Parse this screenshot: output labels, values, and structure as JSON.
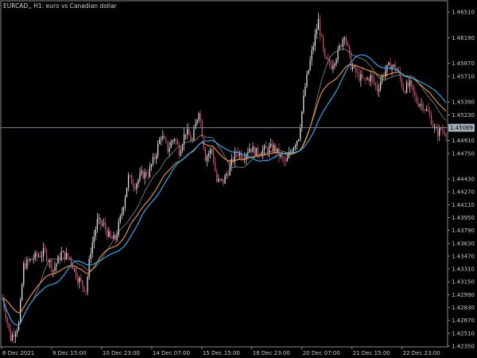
{
  "header": {
    "title": "EURCAD,, H1:  euro vs Canadian dollar"
  },
  "colors": {
    "background": "#000000",
    "axis": "#8a8a8a",
    "text": "#c8c8c8",
    "bull_candle": "#e8e8e8",
    "bear_candle": "#d0506e",
    "ma_fast": "#8a8a8a",
    "ma_orange": "#f59a3c",
    "ma_blue": "#29a8f0",
    "current_price_line": "#7a8f9a",
    "current_price_box": "#9fb1ba"
  },
  "chart_data": {
    "type": "candlestick",
    "ylim": [
      1.4234,
      1.4665
    ],
    "yticks": [
      "1.46510",
      "1.46190",
      "1.45870",
      "1.45710",
      "1.45390",
      "1.45230",
      "1.44910",
      "1.44750",
      "1.44430",
      "1.44270",
      "1.44110",
      "1.43950",
      "1.43790",
      "1.43630",
      "1.43470",
      "1.43310",
      "1.43150",
      "1.42990",
      "1.42830",
      "1.42670",
      "1.42510",
      "1.42350"
    ],
    "xticks": [
      "8 Dec 2021",
      "9 Dec 15:00",
      "10 Dec 23:00",
      "14 Dec 07:00",
      "15 Dec 15:00",
      "16 Dec 23:00",
      "20 Dec 07:00",
      "21 Dec 15:00",
      "22 Dec 23:00"
    ],
    "current_price": "1.45069",
    "anchors": [
      [
        0,
        1.4295
      ],
      [
        5,
        1.4245
      ],
      [
        10,
        1.4262
      ],
      [
        13,
        1.4335
      ],
      [
        19,
        1.4345
      ],
      [
        26,
        1.4352
      ],
      [
        31,
        1.433
      ],
      [
        36,
        1.435
      ],
      [
        41,
        1.4345
      ],
      [
        46,
        1.432
      ],
      [
        51,
        1.4305
      ],
      [
        54,
        1.4355
      ],
      [
        58,
        1.439
      ],
      [
        62,
        1.4385
      ],
      [
        66,
        1.4368
      ],
      [
        69,
        1.4368
      ],
      [
        73,
        1.4402
      ],
      [
        77,
        1.4445
      ],
      [
        81,
        1.4436
      ],
      [
        85,
        1.4448
      ],
      [
        89,
        1.445
      ],
      [
        93,
        1.447
      ],
      [
        97,
        1.4498
      ],
      [
        101,
        1.448
      ],
      [
        105,
        1.4495
      ],
      [
        108,
        1.4478
      ],
      [
        112,
        1.4503
      ],
      [
        116,
        1.449
      ],
      [
        120,
        1.453
      ],
      [
        124,
        1.447
      ],
      [
        128,
        1.448
      ],
      [
        131,
        1.444
      ],
      [
        135,
        1.444
      ],
      [
        139,
        1.4458
      ],
      [
        143,
        1.4477
      ],
      [
        147,
        1.4472
      ],
      [
        151,
        1.4482
      ],
      [
        155,
        1.4476
      ],
      [
        158,
        1.4478
      ],
      [
        162,
        1.448
      ],
      [
        166,
        1.4482
      ],
      [
        170,
        1.447
      ],
      [
        173,
        1.4462
      ],
      [
        177,
        1.4482
      ],
      [
        181,
        1.4496
      ],
      [
        185,
        1.4558
      ],
      [
        189,
        1.46
      ],
      [
        193,
        1.464
      ],
      [
        197,
        1.459
      ],
      [
        201,
        1.4585
      ],
      [
        205,
        1.46
      ],
      [
        209,
        1.4625
      ],
      [
        213,
        1.4585
      ],
      [
        217,
        1.4572
      ],
      [
        221,
        1.4565
      ],
      [
        225,
        1.457
      ],
      [
        229,
        1.4555
      ],
      [
        233,
        1.4575
      ],
      [
        237,
        1.4585
      ],
      [
        241,
        1.458
      ],
      [
        245,
        1.4555
      ],
      [
        249,
        1.456
      ],
      [
        253,
        1.454
      ],
      [
        257,
        1.4535
      ],
      [
        261,
        1.4522
      ],
      [
        265,
        1.45
      ],
      [
        268,
        1.4505
      ],
      [
        271,
        1.4502
      ]
    ],
    "candle_count": 272,
    "moving_averages": [
      {
        "color_key": "ma_fast",
        "period": 12
      },
      {
        "color_key": "ma_orange",
        "period": 34
      },
      {
        "color_key": "ma_blue",
        "period": 34
      }
    ]
  }
}
